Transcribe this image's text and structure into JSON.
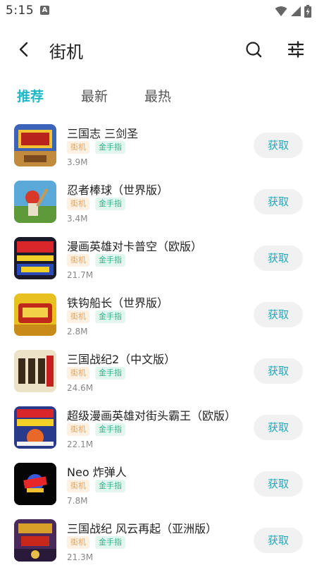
{
  "status_bar": {
    "time": "5:15",
    "notification_letter": "A"
  },
  "header": {
    "title": "街机"
  },
  "tabs": [
    {
      "label": "推荐",
      "active": true
    },
    {
      "label": "最新",
      "active": false
    },
    {
      "label": "最热",
      "active": false
    }
  ],
  "items": [
    {
      "name": "三国志 三剑圣",
      "tags": [
        "街机",
        "金手指"
      ],
      "size": "3.9M",
      "action": "获取"
    },
    {
      "name": "忍者棒球（世界版）",
      "tags": [
        "街机",
        "金手指"
      ],
      "size": "3.4M",
      "action": "获取"
    },
    {
      "name": "漫画英雄对卡普空（欧版）",
      "tags": [
        "街机",
        "金手指"
      ],
      "size": "21.7M",
      "action": "获取"
    },
    {
      "name": "铁钩船长（世界版）",
      "tags": [
        "街机",
        "金手指"
      ],
      "size": "2.8M",
      "action": "获取"
    },
    {
      "name": "三国战纪2（中文版）",
      "tags": [
        "街机",
        "金手指"
      ],
      "size": "24.6M",
      "action": "获取"
    },
    {
      "name": "超级漫画英雄对街头霸王（欧版）",
      "tags": [
        "街机",
        "金手指"
      ],
      "size": "22.1M",
      "action": "获取"
    },
    {
      "name": "Neo 炸弹人",
      "tags": [
        "街机",
        "金手指"
      ],
      "size": "7.8M",
      "action": "获取"
    },
    {
      "name": "三国战纪 风云再起（亚洲版）",
      "tags": [
        "街机",
        "金手指"
      ],
      "size": "21.3M",
      "action": "获取"
    }
  ],
  "colors": {
    "accent": "#20b8c4",
    "button_text": "#20a9b6",
    "tag_arcade": "#e8a25a",
    "tag_cheat": "#2fb38a"
  }
}
